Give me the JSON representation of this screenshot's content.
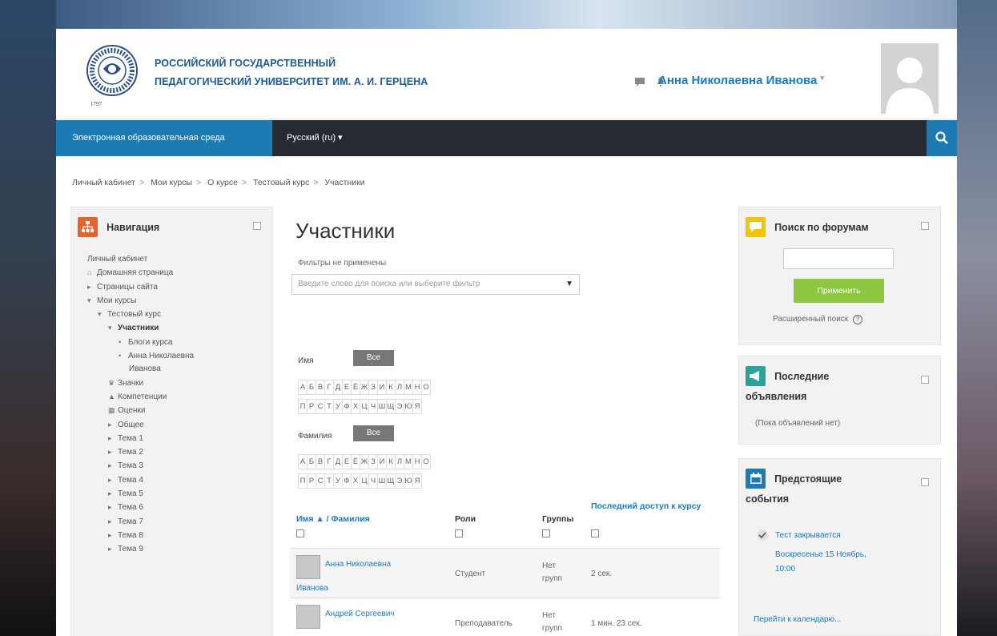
{
  "header": {
    "university_line1": "РОССИЙСКИЙ ГОСУДАРСТВЕННЫЙ",
    "university_line2": "ПЕДАГОГИЧЕСКИЙ УНИВЕРСИТЕТ ИМ. А. И. ГЕРЦЕНА",
    "logo_year": "1797",
    "user_name": "Анна Николаевна Иванова"
  },
  "navbar": {
    "site_name": "Электронная образовательная среда",
    "language": "Русский (ru) ▾"
  },
  "breadcrumb": [
    "Личный кабинет",
    "Мои курсы",
    "О курсе",
    "Тестовый курс",
    "Участники"
  ],
  "navigation_block": {
    "title": "Навигация",
    "items": [
      {
        "label": "Личный кабинет",
        "depth": 0,
        "icon": "none"
      },
      {
        "label": "Домашняя страница",
        "depth": 0,
        "icon": "home-icon"
      },
      {
        "label": "Страницы сайта",
        "depth": 0,
        "icon": "caret-right-icon"
      },
      {
        "label": "Мои курсы",
        "depth": 0,
        "icon": "caret-down-icon"
      },
      {
        "label": "Тестовый курс",
        "depth": 1,
        "icon": "caret-down-icon"
      },
      {
        "label": "Участники",
        "depth": 2,
        "icon": "caret-down-icon",
        "bold": true
      },
      {
        "label": "Блоги курса",
        "depth": 3,
        "icon": "bullet-icon"
      },
      {
        "label": "Анна Николаевна",
        "depth": 3,
        "icon": "bullet-icon"
      },
      {
        "label": "Иванова",
        "depth": 4,
        "icon": "none"
      },
      {
        "label": "Значки",
        "depth": 2,
        "icon": "trophy-icon"
      },
      {
        "label": "Компетенции",
        "depth": 2,
        "icon": "competency-icon"
      },
      {
        "label": "Оценки",
        "depth": 2,
        "icon": "grades-icon"
      },
      {
        "label": "Общее",
        "depth": 2,
        "icon": "caret-right-icon"
      },
      {
        "label": "Тема 1",
        "depth": 2,
        "icon": "caret-right-icon"
      },
      {
        "label": "Тема 2",
        "depth": 2,
        "icon": "caret-right-icon"
      },
      {
        "label": "Тема 3",
        "depth": 2,
        "icon": "caret-right-icon"
      },
      {
        "label": "Тема 4",
        "depth": 2,
        "icon": "caret-right-icon"
      },
      {
        "label": "Тема 5",
        "depth": 2,
        "icon": "caret-right-icon"
      },
      {
        "label": "Тема 6",
        "depth": 2,
        "icon": "caret-right-icon"
      },
      {
        "label": "Тема 7",
        "depth": 2,
        "icon": "caret-right-icon"
      },
      {
        "label": "Тема 8",
        "depth": 2,
        "icon": "caret-right-icon"
      },
      {
        "label": "Тема 9",
        "depth": 2,
        "icon": "caret-right-icon"
      }
    ]
  },
  "main": {
    "title": "Участники",
    "filters_status": "Фильтры не применены",
    "filter_placeholder": "Введите слово для поиска или выберите фильтр",
    "firstname_label": "Имя",
    "lastname_label": "Фамилия",
    "all_label": "Все",
    "letters_row1": [
      "А",
      "Б",
      "В",
      "Г",
      "Д",
      "Е",
      "Ё",
      "Ж",
      "З",
      "И",
      "К",
      "Л",
      "М",
      "Н",
      "О"
    ],
    "letters_row2": [
      "П",
      "Р",
      "С",
      "Т",
      "У",
      "Ф",
      "Х",
      "Ц",
      "Ч",
      "Ш",
      "Щ",
      "Э",
      "Ю",
      "Я"
    ],
    "columns": {
      "name": "Имя ▲ / Фамилия",
      "roles": "Роли",
      "groups": "Группы",
      "last_access": "Последний доступ к курсу"
    },
    "rows": [
      {
        "name_line1": "Анна Николаевна",
        "name_line2": "Иванова",
        "role": "Студент",
        "group_line1": "Нет",
        "group_line2": "групп",
        "last_access": "2 сек."
      },
      {
        "name_line1": "Андрей Сергеевич",
        "name_line2": "",
        "role": "Преподаватель",
        "group_line1": "Нет",
        "group_line2": "групп",
        "last_access": "1 мин. 23 сек."
      }
    ]
  },
  "forum_search": {
    "title": "Поиск по форумам",
    "apply_label": "Применить",
    "advanced_label": "Расширенный поиск"
  },
  "news": {
    "title_line1": "Последние",
    "title_line2": "объявления",
    "empty": "(Пока объявлений нет)"
  },
  "events": {
    "title_line1": "Предстоящие",
    "title_line2": "события",
    "event_title": "Тест закрывается",
    "event_date_line1": "Воскресенье 15 Ноябрь,",
    "event_date_line2": "10:00",
    "calendar_link": "Перейти к календарю..."
  },
  "colors": {
    "brand_blue": "#1d7bb3",
    "nav_dark": "#262b33",
    "link": "#1a7ac6",
    "apply_green": "#8dc63f",
    "nav_icon_red": "#e8622c",
    "forum_icon_yellow": "#f5c400",
    "news_icon_teal": "#2aa498",
    "events_icon_blue": "#1d7bb3"
  }
}
